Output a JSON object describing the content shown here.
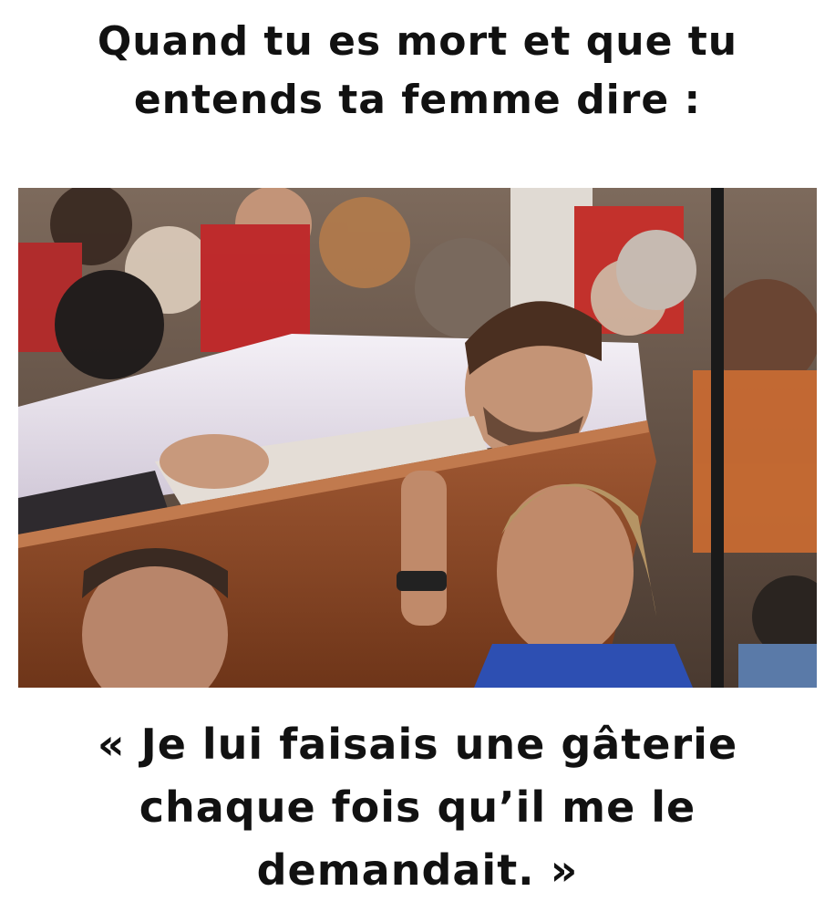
{
  "top_caption": {
    "line1": "Quand tu es mort et que tu",
    "line2": "entends ta femme dire :"
  },
  "photo": {
    "scene": "funeral-crowd-carrying-coffin"
  },
  "bottom_caption": {
    "line1": "« Je lui faisais une gâterie",
    "line2": "chaque fois qu’il me le",
    "line3": "demandait. »"
  },
  "colors": {
    "background": "#ffffff",
    "text": "#111111",
    "coffin_wood": "#8a4a2c",
    "coffin_lining": "#e9e4ee"
  }
}
